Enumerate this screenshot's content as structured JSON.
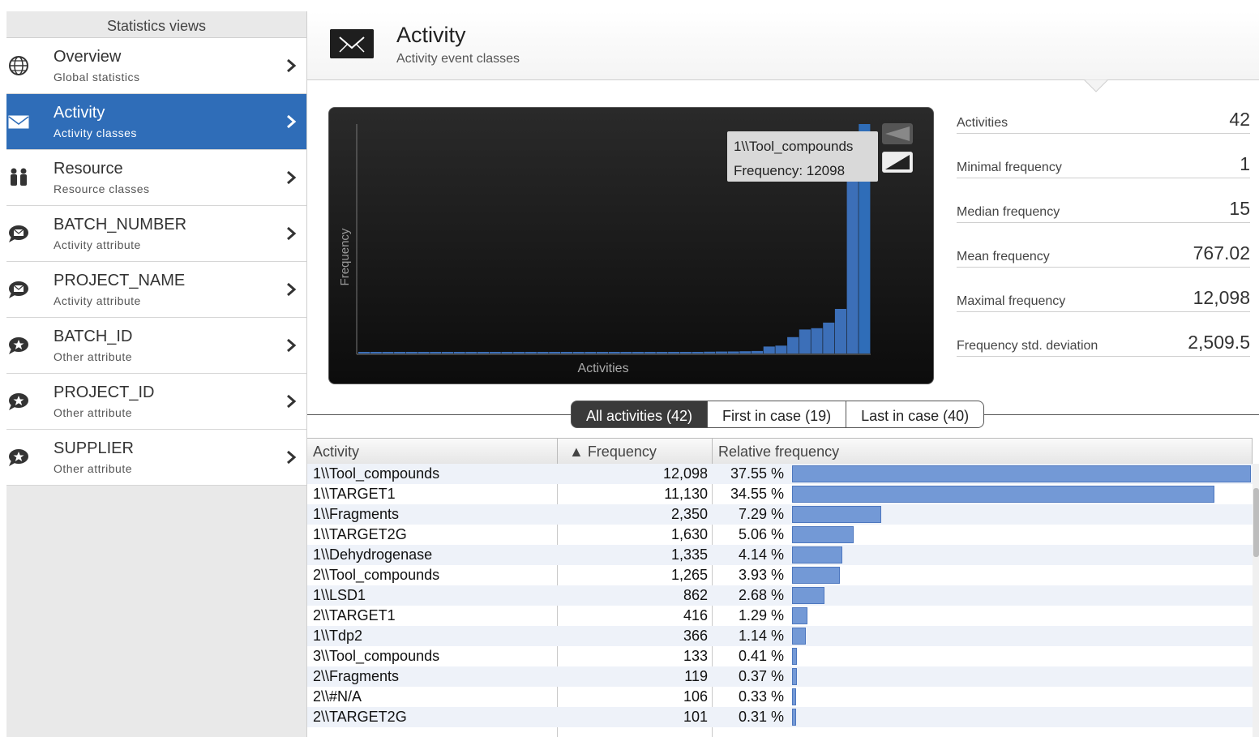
{
  "sidebar": {
    "title": "Statistics views",
    "items": [
      {
        "title": "Overview",
        "subtitle": "Global statistics",
        "icon": "globe-icon",
        "active": false
      },
      {
        "title": "Activity",
        "subtitle": "Activity classes",
        "icon": "envelope-icon",
        "active": true
      },
      {
        "title": "Resource",
        "subtitle": "Resource classes",
        "icon": "people-icon",
        "active": false
      },
      {
        "title": "BATCH_NUMBER",
        "subtitle": "Activity attribute",
        "icon": "speech-envelope-icon",
        "active": false
      },
      {
        "title": "PROJECT_NAME",
        "subtitle": "Activity attribute",
        "icon": "speech-envelope-icon",
        "active": false
      },
      {
        "title": "BATCH_ID",
        "subtitle": "Other attribute",
        "icon": "speech-star-icon",
        "active": false
      },
      {
        "title": "PROJECT_ID",
        "subtitle": "Other attribute",
        "icon": "speech-star-icon",
        "active": false
      },
      {
        "title": "SUPPLIER",
        "subtitle": "Other attribute",
        "icon": "speech-star-icon",
        "active": false
      }
    ]
  },
  "header": {
    "title": "Activity",
    "subtitle": "Activity event classes",
    "icon": "envelope-icon"
  },
  "chart_data": {
    "type": "bar",
    "xlabel": "Activities",
    "ylabel": "Frequency",
    "ylim": [
      0,
      12098
    ],
    "values": [
      2,
      4,
      6,
      8,
      10,
      12,
      14,
      16,
      18,
      20,
      22,
      24,
      26,
      28,
      30,
      32,
      34,
      36,
      38,
      40,
      42,
      45,
      48,
      52,
      57,
      62,
      68,
      75,
      83,
      92,
      101,
      106,
      119,
      133,
      366,
      416,
      862,
      1265,
      1335,
      1630,
      2350,
      11130,
      12098
    ],
    "highlight_color": "#2f6db8",
    "bar_color": "#3c6fb8",
    "tooltip": {
      "line1": "1\\\\Tool_compounds",
      "line2": "Frequency: 12098"
    }
  },
  "stats": [
    {
      "label": "Activities",
      "value": "42"
    },
    {
      "label": "Minimal frequency",
      "value": "1"
    },
    {
      "label": "Median frequency",
      "value": "15"
    },
    {
      "label": "Mean frequency",
      "value": "767.02"
    },
    {
      "label": "Maximal frequency",
      "value": "12,098"
    },
    {
      "label": "Frequency std. deviation",
      "value": "2,509.5"
    }
  ],
  "tabs": [
    {
      "label": "All activities (42)",
      "active": true
    },
    {
      "label": "First in case (19)",
      "active": false
    },
    {
      "label": "Last in case (40)",
      "active": false
    }
  ],
  "table": {
    "columns": [
      "Activity",
      "▲ Frequency",
      "Relative frequency"
    ],
    "rows": [
      {
        "activity": "1\\\\Tool_compounds",
        "frequency": "12,098",
        "relative": "37.55 %",
        "pct": 37.55
      },
      {
        "activity": "1\\\\TARGET1",
        "frequency": "11,130",
        "relative": "34.55 %",
        "pct": 34.55
      },
      {
        "activity": "1\\\\Fragments",
        "frequency": "2,350",
        "relative": "7.29 %",
        "pct": 7.29
      },
      {
        "activity": "1\\\\TARGET2G",
        "frequency": "1,630",
        "relative": "5.06 %",
        "pct": 5.06
      },
      {
        "activity": "1\\\\Dehydrogenase",
        "frequency": "1,335",
        "relative": "4.14 %",
        "pct": 4.14
      },
      {
        "activity": "2\\\\Tool_compounds",
        "frequency": "1,265",
        "relative": "3.93 %",
        "pct": 3.93
      },
      {
        "activity": "1\\\\LSD1",
        "frequency": "862",
        "relative": "2.68 %",
        "pct": 2.68
      },
      {
        "activity": "2\\\\TARGET1",
        "frequency": "416",
        "relative": "1.29 %",
        "pct": 1.29
      },
      {
        "activity": "1\\\\Tdp2",
        "frequency": "366",
        "relative": "1.14 %",
        "pct": 1.14
      },
      {
        "activity": "3\\\\Tool_compounds",
        "frequency": "133",
        "relative": "0.41 %",
        "pct": 0.41
      },
      {
        "activity": "2\\\\Fragments",
        "frequency": "119",
        "relative": "0.37 %",
        "pct": 0.37
      },
      {
        "activity": "2\\\\#N/A",
        "frequency": "106",
        "relative": "0.33 %",
        "pct": 0.33
      },
      {
        "activity": "2\\\\TARGET2G",
        "frequency": "101",
        "relative": "0.31 %",
        "pct": 0.31
      }
    ]
  }
}
